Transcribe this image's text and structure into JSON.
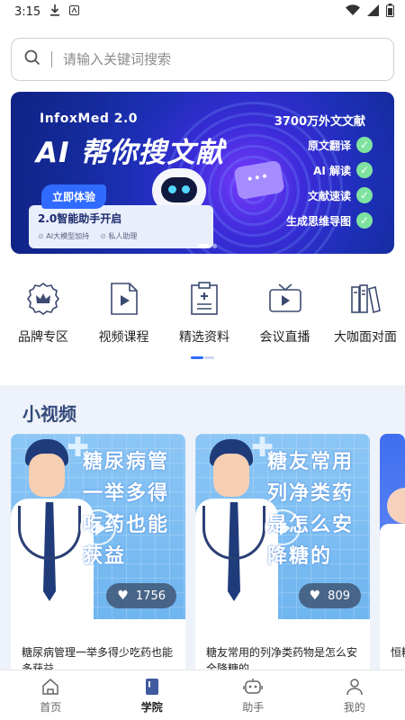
{
  "status_bar": {
    "time": "3:15"
  },
  "search": {
    "placeholder": "请输入关键词搜索"
  },
  "banner": {
    "brand": "InfoxMed 2.0",
    "headline": "AI 帮你搜文献",
    "try_label": "立即体验",
    "sub_title": "2.0智能助手开启",
    "sub_tags": [
      "AI大模型加持",
      "私人助理"
    ],
    "right_title": "3700万外文文献",
    "features": [
      "原文翻译",
      "AI 解读",
      "文献速读",
      "生成思维导图"
    ],
    "accent_color": "#2f6bff"
  },
  "categories": [
    {
      "label": "品牌专区",
      "icon": "crown-badge-icon"
    },
    {
      "label": "视频课程",
      "icon": "video-file-icon"
    },
    {
      "label": "精选资料",
      "icon": "medical-document-icon"
    },
    {
      "label": "会议直播",
      "icon": "tv-live-icon"
    },
    {
      "label": "大咖面对面",
      "icon": "books-icon"
    }
  ],
  "short_videos": {
    "title": "小视频",
    "items": [
      {
        "thumb_lines": [
          "糖尿病管",
          "一举多得",
          "吃药也能",
          "获益"
        ],
        "likes": "1756",
        "caption": "糖尿病管理一举多得少吃药也能多获益"
      },
      {
        "thumb_lines": [
          "糖友常用",
          "列净类药",
          "是怎么安",
          "降糖的"
        ],
        "likes": "809",
        "caption": "糖友常用的列净类药物是怎么安全降糖的"
      },
      {
        "caption": "恒糖"
      }
    ]
  },
  "tabbar": {
    "items": [
      {
        "label": "首页",
        "icon": "home-icon",
        "active": false
      },
      {
        "label": "学院",
        "icon": "book-icon",
        "active": true
      },
      {
        "label": "助手",
        "icon": "robot-icon",
        "active": false
      },
      {
        "label": "我的",
        "icon": "user-icon",
        "active": false
      }
    ]
  }
}
